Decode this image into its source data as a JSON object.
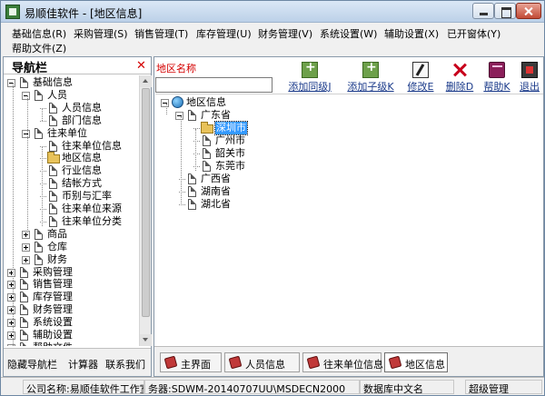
{
  "window": {
    "title": "易顺佳软件 - [地区信息]"
  },
  "menu": [
    "基础信息(R)",
    "采购管理(S)",
    "销售管理(T)",
    "库存管理(U)",
    "财务管理(V)",
    "系统设置(W)",
    "辅助设置(X)",
    "已开窗体(Y)",
    "帮助文件(Z)"
  ],
  "nav": {
    "title": "导航栏",
    "close_glyph": "✕",
    "tree": [
      {
        "label": "基础信息",
        "icon": "document",
        "expander": "minus"
      },
      {
        "label": "人员",
        "icon": "document",
        "expander": "minus"
      },
      {
        "label": "人员信息",
        "icon": "document"
      },
      {
        "label": "部门信息",
        "icon": "document"
      },
      {
        "label": "往来单位",
        "icon": "document",
        "expander": "minus"
      },
      {
        "label": "往来单位信息",
        "icon": "document"
      },
      {
        "label": "地区信息",
        "icon": "folder-open"
      },
      {
        "label": "行业信息",
        "icon": "document"
      },
      {
        "label": "结帐方式",
        "icon": "document"
      },
      {
        "label": "币别与汇率",
        "icon": "document"
      },
      {
        "label": "往来单位来源",
        "icon": "document"
      },
      {
        "label": "往来单位分类",
        "icon": "document"
      },
      {
        "label": "商品",
        "icon": "document",
        "expander": "plus"
      },
      {
        "label": "仓库",
        "icon": "document",
        "expander": "plus"
      },
      {
        "label": "财务",
        "icon": "document",
        "expander": "plus"
      },
      {
        "label": "采购管理",
        "icon": "document",
        "expander": "plus"
      },
      {
        "label": "销售管理",
        "icon": "document",
        "expander": "plus"
      },
      {
        "label": "库存管理",
        "icon": "document",
        "expander": "plus"
      },
      {
        "label": "财务管理",
        "icon": "document",
        "expander": "plus"
      },
      {
        "label": "系统设置",
        "icon": "document",
        "expander": "plus"
      },
      {
        "label": "辅助设置",
        "icon": "document",
        "expander": "plus"
      },
      {
        "label": "帮助文件",
        "icon": "document",
        "expander": "plus"
      }
    ],
    "footer_links": [
      "隐藏导航栏",
      "计算器",
      "联系我们"
    ]
  },
  "main": {
    "field_label": "地区名称",
    "field_value": "",
    "toolbar": [
      {
        "label": "添加同级J",
        "icon": "add-sibling-icon"
      },
      {
        "label": "添加子级K",
        "icon": "add-child-icon"
      },
      {
        "label": "修改E",
        "icon": "edit-icon"
      },
      {
        "label": "删除D",
        "icon": "delete-icon"
      },
      {
        "label": "帮助K",
        "icon": "help-book-icon"
      },
      {
        "label": "退出",
        "icon": "exit-icon"
      }
    ],
    "region_tree": [
      {
        "label": "地区信息",
        "icon": "globe",
        "expander": "minus"
      },
      {
        "label": "广东省",
        "icon": "document",
        "expander": "minus"
      },
      {
        "label": "深圳市",
        "icon": "folder-open",
        "selected": true
      },
      {
        "label": "广州市",
        "icon": "document"
      },
      {
        "label": "韶关市",
        "icon": "document"
      },
      {
        "label": "东莞市",
        "icon": "document"
      },
      {
        "label": "广西省",
        "icon": "document"
      },
      {
        "label": "湖南省",
        "icon": "document"
      },
      {
        "label": "湖北省",
        "icon": "document"
      }
    ],
    "tabs": [
      {
        "label": "主界面",
        "active": false
      },
      {
        "label": "人员信息",
        "active": false
      },
      {
        "label": "往来单位信息",
        "active": false
      },
      {
        "label": "地区信息",
        "active": true
      }
    ]
  },
  "status": {
    "company": "公司名称:易顺佳软件工作室",
    "server": "务器:SDWM-20140707UU\\MSDECN2000",
    "database": "数据库中文名",
    "user": "超级管理"
  }
}
